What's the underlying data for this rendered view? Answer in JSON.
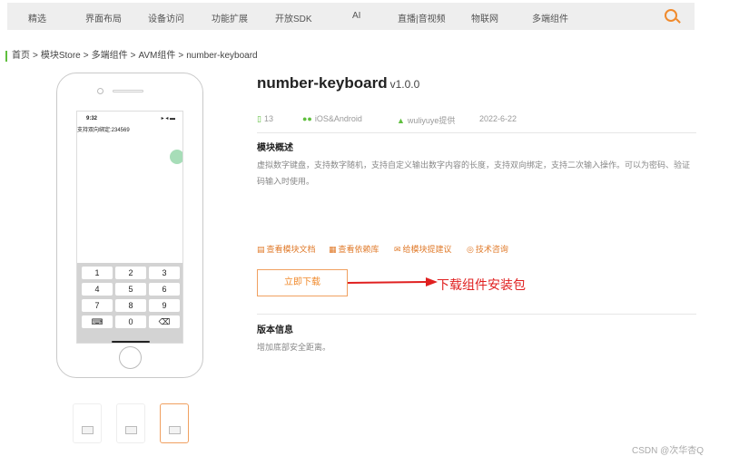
{
  "nav": {
    "items": [
      "精选",
      "界面布局",
      "设备访问",
      "功能扩展",
      "开放SDK",
      "AI",
      "直播|音视频",
      "物联网",
      "多端组件"
    ],
    "search_icon": "search-icon"
  },
  "breadcrumb": [
    "首页",
    ">",
    "模块Store",
    ">",
    "多端组件",
    ">",
    "AVM组件",
    ">",
    "number-keyboard"
  ],
  "phone": {
    "time": "9:32",
    "status": "▸ ◂ ▬",
    "bind_text": "支持双向绑定:234569",
    "keys": [
      "1",
      "2",
      "3",
      "4",
      "5",
      "6",
      "7",
      "8",
      "9",
      "",
      "0",
      ""
    ]
  },
  "module": {
    "title": "number-keyboard",
    "version": "v1.0.0",
    "downloads": "13",
    "platform": "iOS&Android",
    "author": "wuliyuye提供",
    "date": "2022-6-22",
    "overview_title": "模块概述",
    "description": "虚拟数字键盘，支持数字随机，支持自定义输出数字内容的长度，支持双向绑定，支持二次输入操作。可以为密码、验证码输入时使用。",
    "links": [
      "查看模块文档",
      "查看依赖库",
      "给模块提建议",
      "技术咨询"
    ],
    "download_button": "立即下载",
    "annotation": "下载组件安装包",
    "version_info_title": "版本信息",
    "version_note": "增加底部安全距离。"
  },
  "watermark": "CSDN @次华杏Q",
  "colors": {
    "accent": "#f08a2c",
    "green": "#5fbf3e",
    "annotation": "#e02020"
  }
}
